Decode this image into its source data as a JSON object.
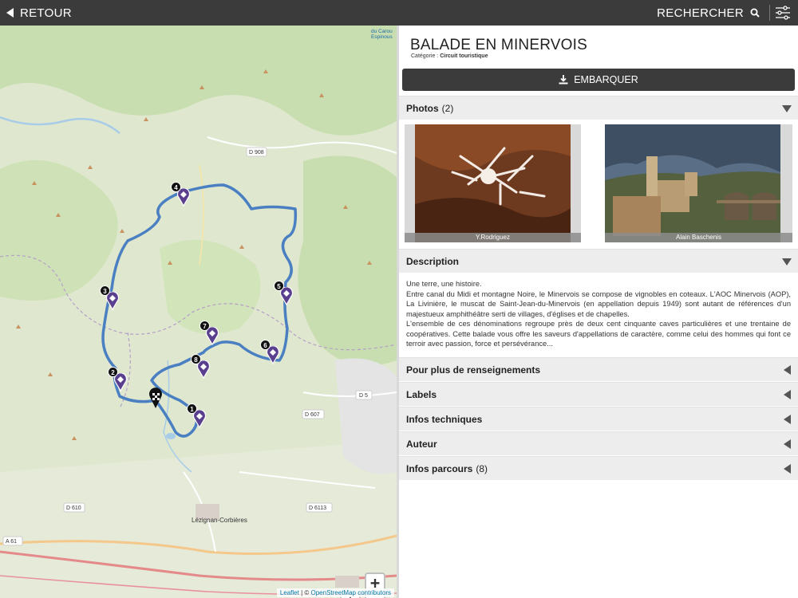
{
  "topbar": {
    "back_label": "RETOUR",
    "search_label": "RECHERCHER",
    "icons": [
      "back-arrow-icon",
      "search-icon",
      "filter-sliders-icon"
    ]
  },
  "map": {
    "labels": {
      "d908": "D 908",
      "d5": "D 5",
      "d607": "D 607",
      "d610": "D 610",
      "d6113": "D 6113",
      "a61": "A 61",
      "town_lezignan": "Lézignan-Corbières",
      "corner_top1": "du Carou",
      "corner_top2": "Espinous"
    },
    "markers": [
      "1",
      "2",
      "3",
      "4",
      "5",
      "6",
      "7",
      "8"
    ],
    "zoom_in": "+",
    "zoom_out": "-",
    "attribution_leaflet": "Leaflet",
    "attribution_sep": " | © ",
    "attribution_osm": "OpenStreetMap contributors",
    "route_color": "#4a7fc1",
    "marker_color": "#5a3f8e"
  },
  "panel": {
    "title": "BALADE EN MINERVOIS",
    "category_label": "Catégorie : ",
    "category_value": "Circuit touristique",
    "embark_label": "EMBARQUER",
    "photos": {
      "label": "Photos",
      "count": "(2)",
      "items": [
        {
          "caption": "Y.Rodriguez"
        },
        {
          "caption": "Alain Baschenis"
        }
      ]
    },
    "description": {
      "label": "Description",
      "lines": [
        "Une terre, une histoire.",
        "Entre canal du Midi et montagne Noire, le Minervois se compose de vignobles en coteaux. L'AOC Minervois (AOP), La Livinière, le muscat de Saint-Jean-du-Minervois (en appellation depuis 1949) sont autant de références d'un majestueux amphithéâtre serti de villages, d'églises et de chapelles.",
        "L'ensemble de ces dénominations regroupe près de deux cent cinquante caves particulières et une trentaine de coopératives. Cette balade vous offre les saveurs d'appellations de caractère, comme celui des hommes qui font ce terroir avec passion, force et persévérance..."
      ]
    },
    "sections": [
      {
        "label": "Pour plus de renseignements",
        "count": ""
      },
      {
        "label": "Labels",
        "count": ""
      },
      {
        "label": "Infos techniques",
        "count": ""
      },
      {
        "label": "Auteur",
        "count": ""
      },
      {
        "label": "Infos parcours",
        "count": "(8)"
      }
    ]
  }
}
